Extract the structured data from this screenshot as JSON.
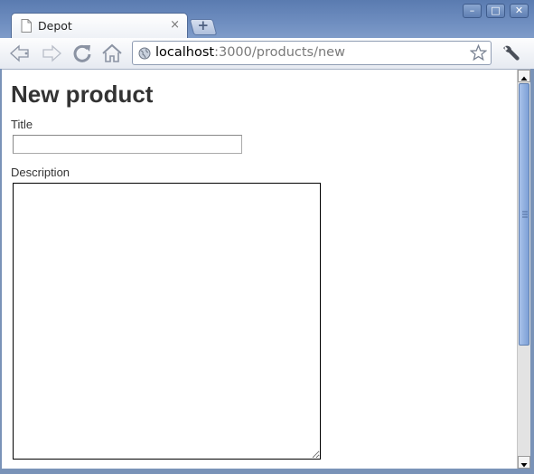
{
  "window": {
    "minimize_label": "–",
    "maximize_label": "□",
    "close_label": "✕"
  },
  "tab": {
    "title": "Depot",
    "close_label": "×",
    "new_tab_label": "+"
  },
  "toolbar": {
    "back_icon": "back-arrow-icon",
    "forward_icon": "forward-arrow-icon",
    "reload_icon": "reload-icon",
    "home_icon": "home-icon",
    "wrench_icon": "wrench-icon"
  },
  "omnibox": {
    "host": "localhost",
    "path": ":3000/products/new",
    "star_icon": "bookmark-star-icon"
  },
  "page": {
    "heading": "New product",
    "title_label": "Title",
    "title_value": "",
    "description_label": "Description",
    "description_value": ""
  },
  "colors": {
    "titlebar": "#6f8ec0",
    "heading_text": "#333333",
    "scroll_thumb": "#7da0d6"
  }
}
